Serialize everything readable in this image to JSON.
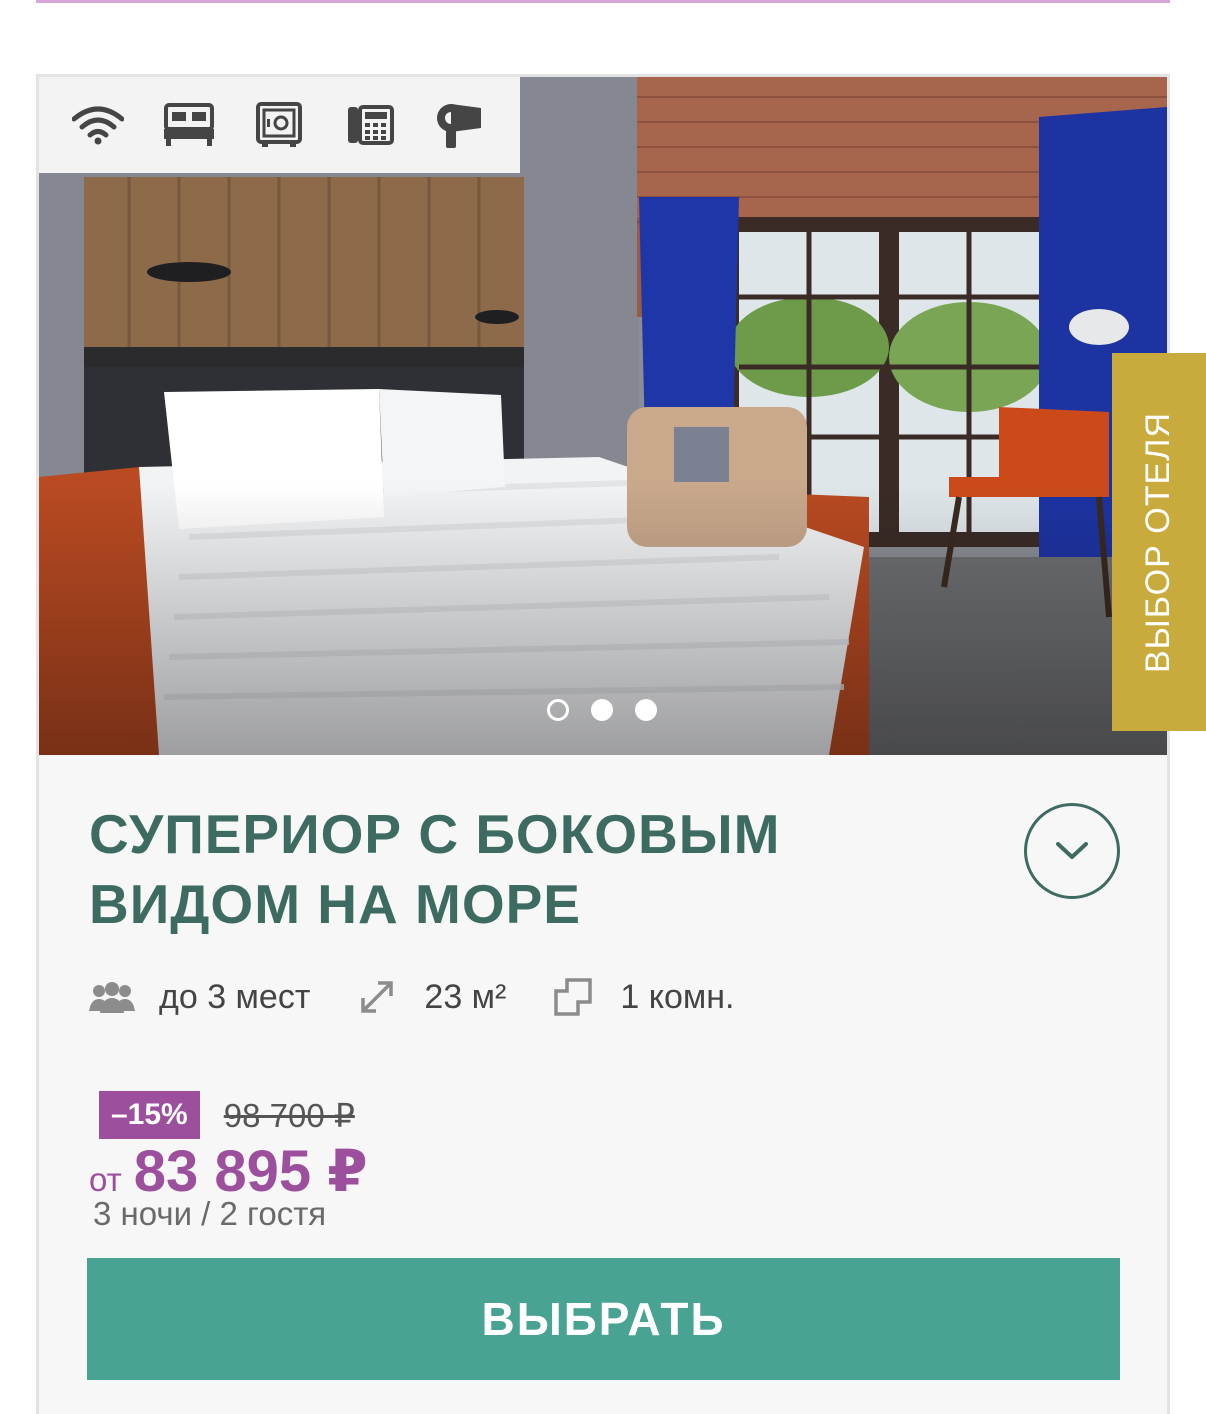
{
  "side_tab": {
    "label": "ВЫБОР ОТЕЛЯ"
  },
  "amenities": [
    "wifi-icon",
    "bed-icon",
    "safe-icon",
    "phone-icon",
    "hairdryer-icon"
  ],
  "gallery": {
    "total": 3,
    "active": 1
  },
  "room": {
    "title": "СУПЕРИОР С БОКОВЫМ ВИДОМ НА МОРЕ",
    "features": {
      "guests": "до 3 мест",
      "area": "23 м²",
      "rooms": "1 комн."
    }
  },
  "pricing": {
    "discount": "–15%",
    "old_price": "98 700 ₽",
    "from_label": "от",
    "price": "83 895 ₽",
    "details": "3 ночи / 2 гостя"
  },
  "actions": {
    "choose_label": "ВЫБРАТЬ"
  },
  "colors": {
    "title": "#3d6b62",
    "accent_purple": "#9b4f9c",
    "button_teal": "#48a393",
    "side_tab_gold": "#c8ab3c"
  }
}
